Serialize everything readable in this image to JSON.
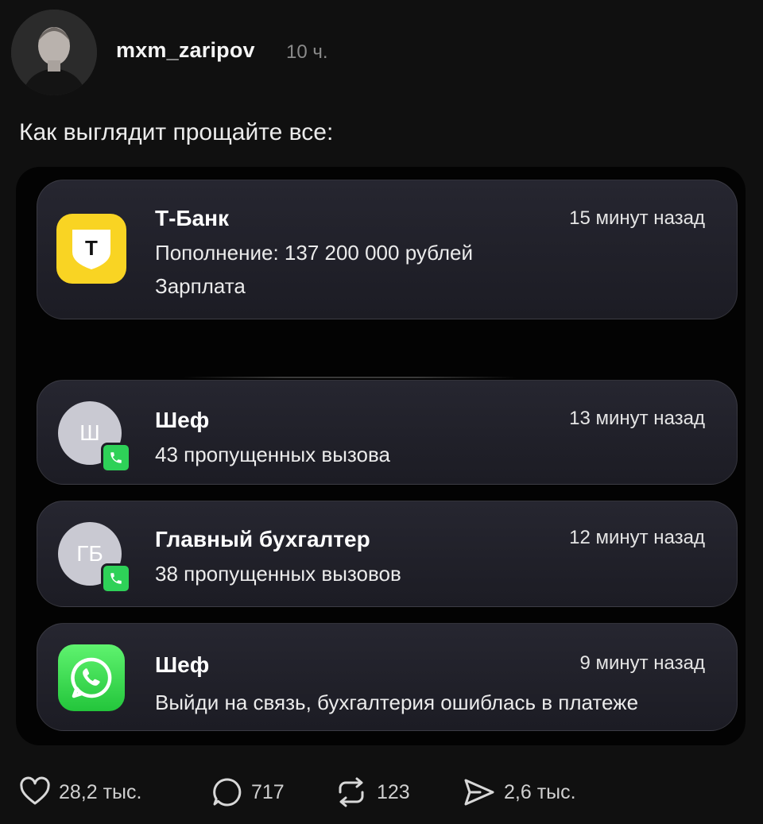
{
  "post": {
    "username": "mxm_zaripov",
    "time_ago": "10 ч.",
    "text": "Как выглядит прощайте все:"
  },
  "notifications": [
    {
      "app": "t-bank",
      "icon_letter": "Т",
      "title": "Т-Банк",
      "time": "15 минут назад",
      "line1": "Пополнение: 137 200 000 рублей",
      "line2": "Зарплата"
    },
    {
      "app": "phone",
      "avatar_initials": "Ш",
      "title": "Шеф",
      "time": "13 минут назад",
      "line1": "43 пропущенных вызова"
    },
    {
      "app": "phone",
      "avatar_initials": "ГБ",
      "title": "Главный бухгалтер",
      "time": "12 минут назад",
      "line1": "38 пропущенных вызовов"
    },
    {
      "app": "whatsapp",
      "title": "Шеф",
      "time": "9 минут назад",
      "line1": "Выйди на связь, бухгалтерия ошиблась в платеже"
    }
  ],
  "actions": {
    "likes": "28,2 тыс.",
    "comments": "717",
    "reposts": "123",
    "shares": "2,6 тыс."
  },
  "colors": {
    "background": "#101010",
    "tbank_yellow": "#f9d423",
    "whatsapp_green": "#2ed158",
    "card": "#23232c"
  },
  "icons": [
    "heart-icon",
    "comment-icon",
    "repost-icon",
    "share-icon",
    "phone-icon",
    "whatsapp-icon"
  ]
}
